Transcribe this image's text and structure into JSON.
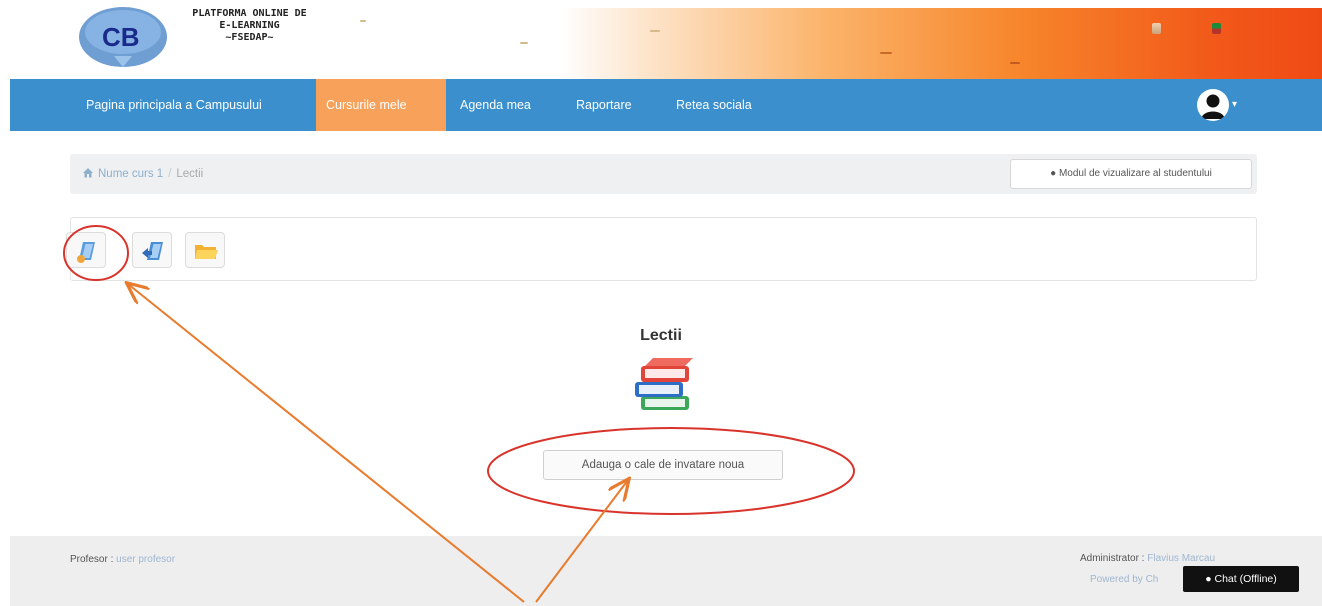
{
  "header": {
    "logo_initials": "CB",
    "title_lines": [
      "PLATFORMA ONLINE DE",
      "E-LEARNING",
      "~FSEDAP~"
    ]
  },
  "navbar": {
    "items": [
      {
        "label": "Pagina principala a Campusului"
      },
      {
        "label": "Cursurile mele"
      },
      {
        "label": "Agenda mea"
      },
      {
        "label": "Raportare"
      },
      {
        "label": "Retea sociala"
      }
    ],
    "active_index": 1,
    "accent_color": "#3a8fcc",
    "active_color": "#f7a15a"
  },
  "breadcrumb": {
    "course": "Nume curs 1",
    "separator": "/",
    "current": "Lectii"
  },
  "student_view_button": "Modul de vizualizare al studentului",
  "toolbar": {
    "buttons": [
      {
        "icon": "add-learnpath-icon"
      },
      {
        "icon": "import-learnpath-icon"
      },
      {
        "icon": "folder-icon"
      }
    ]
  },
  "main": {
    "title": "Lectii",
    "icon": "books-icon",
    "add_button": "Adauga o cale de invatare noua"
  },
  "footer": {
    "teacher_label": "Profesor : ",
    "teacher_name": "user profesor",
    "admin_label": "Administrator : ",
    "admin_name": "Flavius Marcau",
    "powered_by": "Powered by Ch",
    "chat_label": "Chat (Offline)"
  },
  "annotation": {
    "highlight_color": "#d9342b",
    "arrow_color": "#e87b2d"
  }
}
